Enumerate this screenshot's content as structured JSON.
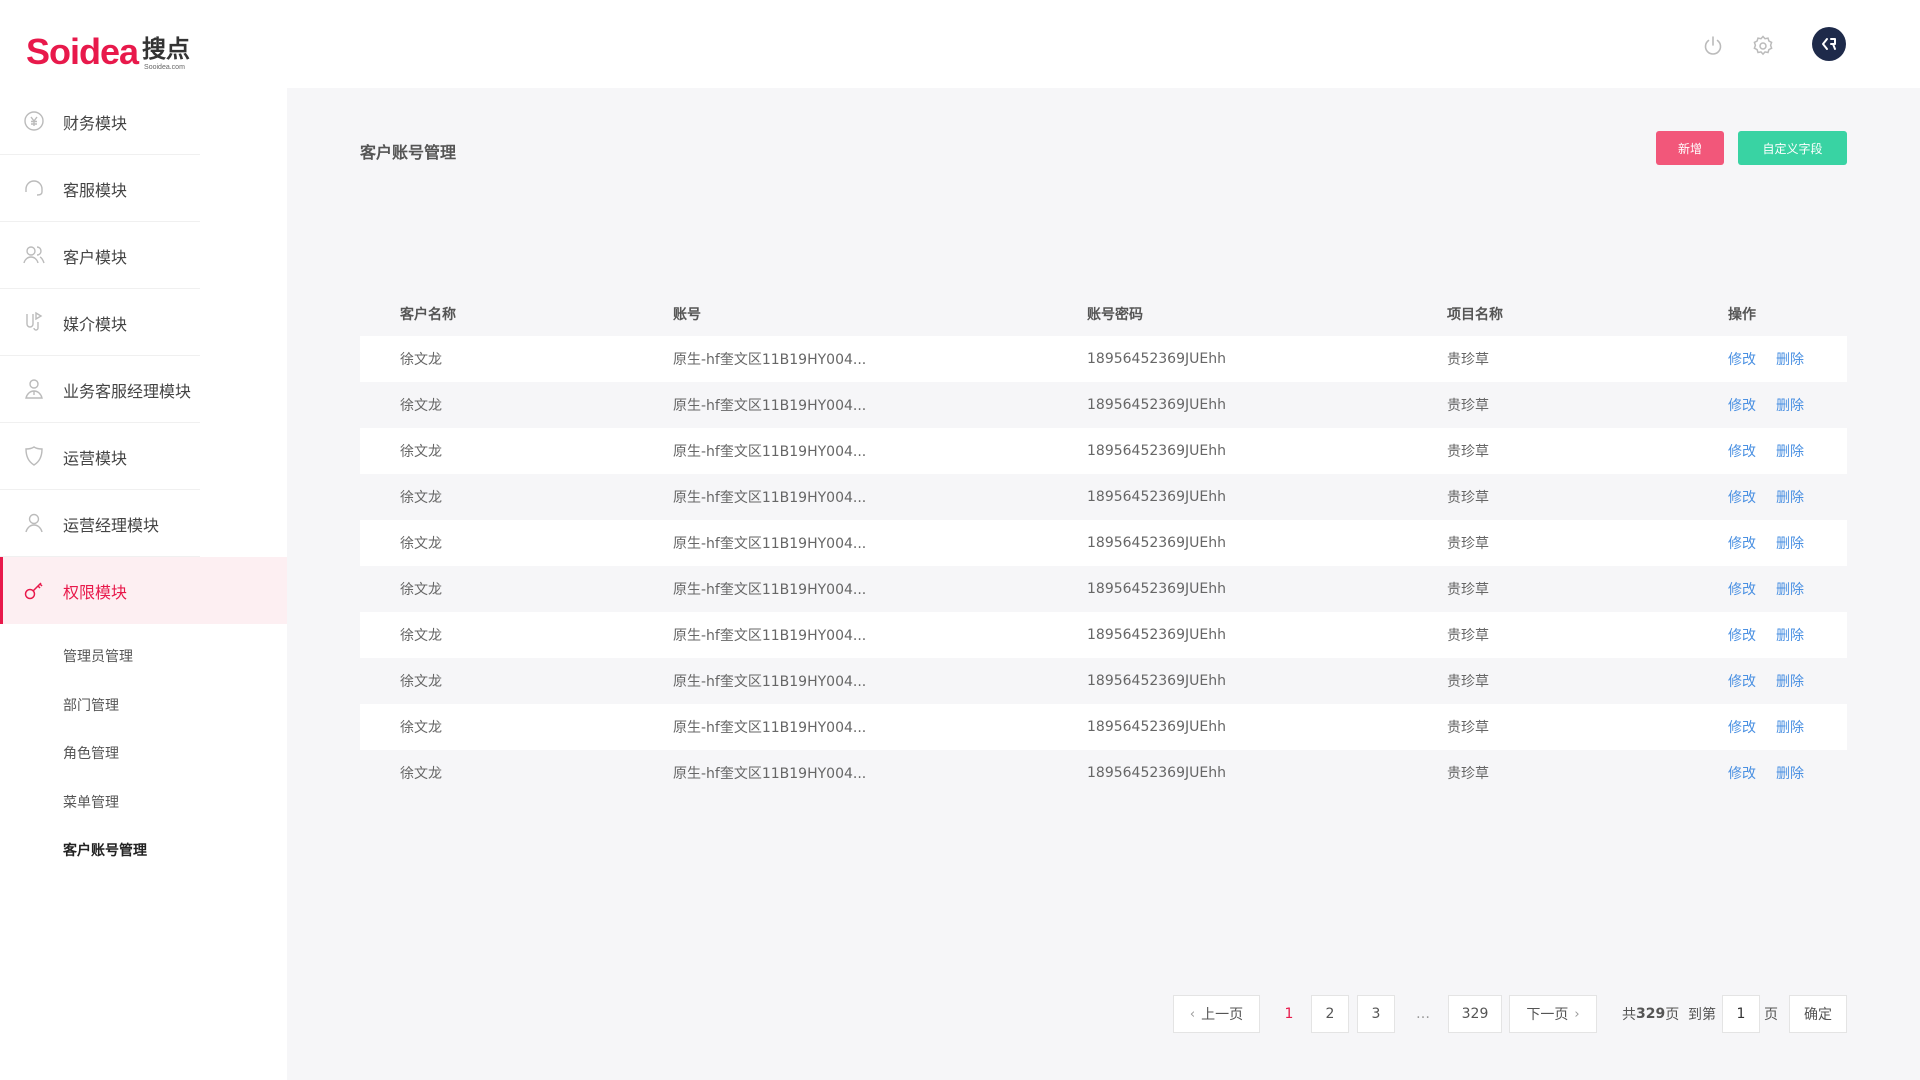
{
  "header": {
    "logo_en": "Soidea",
    "logo_cn": "搜点",
    "logo_url": "Sooidea.com",
    "power_icon": "power-icon",
    "settings_icon": "gear-icon",
    "avatar_icon": "avatar-icon"
  },
  "sidebar": {
    "items": [
      {
        "label": "财务模块",
        "icon": "yen-circle-icon"
      },
      {
        "label": "客服模块",
        "icon": "headset-icon"
      },
      {
        "label": "客户模块",
        "icon": "users-icon"
      },
      {
        "label": "媒介模块",
        "icon": "media-icon"
      },
      {
        "label": "业务客服经理模块",
        "icon": "manager-icon"
      },
      {
        "label": "运营模块",
        "icon": "shield-icon"
      },
      {
        "label": "运营经理模块",
        "icon": "user-icon"
      },
      {
        "label": "权限模块",
        "icon": "key-icon",
        "active": true
      }
    ],
    "subitems": [
      {
        "label": "管理员管理"
      },
      {
        "label": "部门管理"
      },
      {
        "label": "角色管理"
      },
      {
        "label": "菜单管理"
      },
      {
        "label": "客户账号管理",
        "current": true
      }
    ]
  },
  "main": {
    "title": "客户账号管理",
    "add_button": "新增",
    "custom_field_button": "自定义字段",
    "table": {
      "headers": [
        "客户名称",
        "账号",
        "账号密码",
        "项目名称",
        "操作"
      ],
      "rows": [
        [
          "徐文龙",
          "原生-hf奎文区11B19HY004...",
          "18956452369JUEhh",
          "贵珍草"
        ],
        [
          "徐文龙",
          "原生-hf奎文区11B19HY004...",
          "18956452369JUEhh",
          "贵珍草"
        ],
        [
          "徐文龙",
          "原生-hf奎文区11B19HY004...",
          "18956452369JUEhh",
          "贵珍草"
        ],
        [
          "徐文龙",
          "原生-hf奎文区11B19HY004...",
          "18956452369JUEhh",
          "贵珍草"
        ],
        [
          "徐文龙",
          "原生-hf奎文区11B19HY004...",
          "18956452369JUEhh",
          "贵珍草"
        ],
        [
          "徐文龙",
          "原生-hf奎文区11B19HY004...",
          "18956452369JUEhh",
          "贵珍草"
        ],
        [
          "徐文龙",
          "原生-hf奎文区11B19HY004...",
          "18956452369JUEhh",
          "贵珍草"
        ],
        [
          "徐文龙",
          "原生-hf奎文区11B19HY004...",
          "18956452369JUEhh",
          "贵珍草"
        ],
        [
          "徐文龙",
          "原生-hf奎文区11B19HY004...",
          "18956452369JUEhh",
          "贵珍草"
        ],
        [
          "徐文龙",
          "原生-hf奎文区11B19HY004...",
          "18956452369JUEhh",
          "贵珍草"
        ]
      ],
      "edit_label": "修改",
      "delete_label": "删除"
    }
  },
  "pagination": {
    "prev": "上一页",
    "next": "下一页",
    "pages": [
      "1",
      "2",
      "3"
    ],
    "ellipsis": "…",
    "last_page": "329",
    "total_prefix": "共",
    "total_pages": "329",
    "total_suffix": "页",
    "goto_prefix": "到第",
    "goto_value": "1",
    "goto_suffix": "页",
    "confirm": "确定"
  },
  "colors": {
    "brand": "#e8194b",
    "add_button": "#f2577a",
    "custom_button": "#39d3a3",
    "link": "#4a90e2",
    "avatar_bg": "#1e2a4a"
  }
}
